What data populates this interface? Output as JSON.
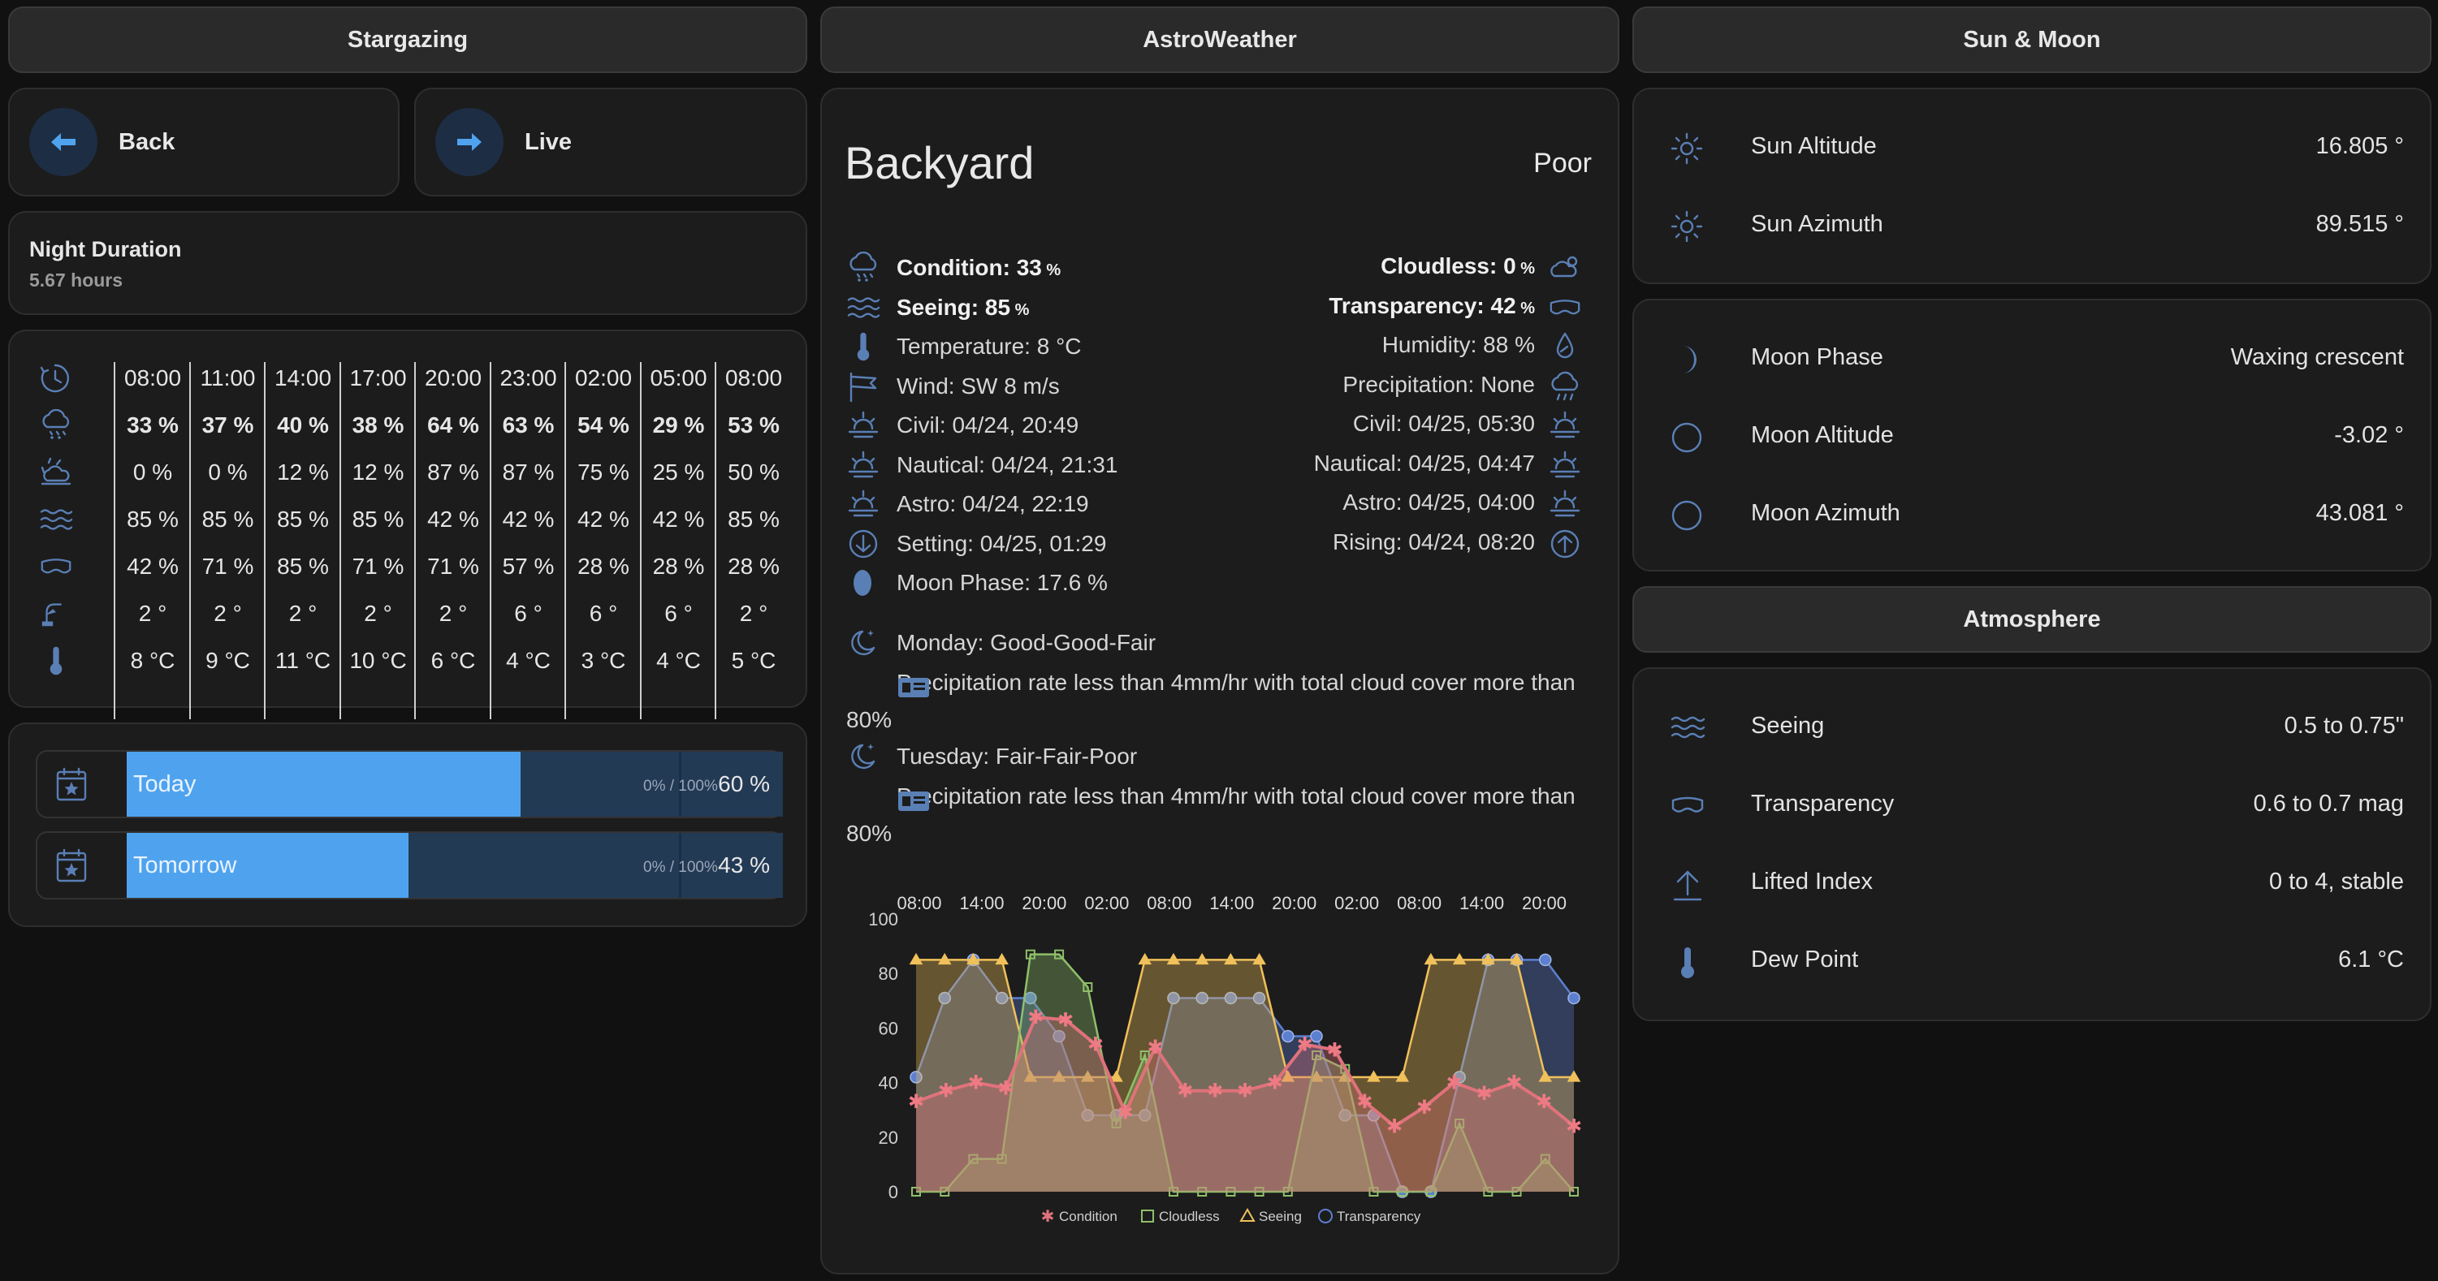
{
  "headers": {
    "left": "Stargazing",
    "middle": "AstroWeather",
    "right": "Sun & Moon",
    "atmosphere": "Atmosphere"
  },
  "nav": {
    "back": "Back",
    "live": "Live"
  },
  "night": {
    "title": "Night Duration",
    "value": "5.67 hours"
  },
  "forecast": {
    "times": [
      "08:00",
      "11:00",
      "14:00",
      "17:00",
      "20:00",
      "23:00",
      "02:00",
      "05:00",
      "08:00"
    ],
    "condition": [
      "33 %",
      "37 %",
      "40 %",
      "38 %",
      "64 %",
      "63 %",
      "54 %",
      "29 %",
      "53 %"
    ],
    "cloudless": [
      "0 %",
      "0 %",
      "12 %",
      "12 %",
      "87 %",
      "87 %",
      "75 %",
      "25 %",
      "50 %"
    ],
    "seeing": [
      "85 %",
      "85 %",
      "85 %",
      "85 %",
      "42 %",
      "42 %",
      "42 %",
      "42 %",
      "85 %"
    ],
    "transparency": [
      "42 %",
      "71 %",
      "85 %",
      "71 %",
      "71 %",
      "57 %",
      "28 %",
      "28 %",
      "28 %"
    ],
    "lifted": [
      "2 °",
      "2 °",
      "2 °",
      "2 °",
      "2 °",
      "6 °",
      "6 °",
      "6 °",
      "2 °"
    ],
    "temperature": [
      "8 °C",
      "9 °C",
      "11 °C",
      "10 °C",
      "6 °C",
      "4 °C",
      "3 °C",
      "4 °C",
      "5 °C"
    ]
  },
  "progress": [
    {
      "label": "Today",
      "range": "0% / 100%",
      "pct_text": "60 %",
      "value": 0.6
    },
    {
      "label": "Tomorrow",
      "range": "0% / 100%",
      "pct_text": "43 %",
      "value": 0.43
    }
  ],
  "astro": {
    "location": "Backyard",
    "rating": "Poor",
    "left": {
      "condition_label": "Condition: 33",
      "condition_unit": " %",
      "seeing_label": "Seeing: 85",
      "seeing_unit": " %",
      "temperature": "Temperature: 8 °C",
      "wind": "Wind: SW 8 m/s",
      "civil": "Civil: 04/24, 20:49",
      "nautical": "Nautical: 04/24, 21:31",
      "astro": "Astro: 04/24, 22:19",
      "setting": "Setting: 04/25, 01:29",
      "moon": "Moon Phase: 17.6 %"
    },
    "right": {
      "cloudless_label": "Cloudless: 0",
      "cloudless_unit": " %",
      "transparency_label": "Transparency: 42",
      "transparency_unit": " %",
      "humidity": "Humidity: 88 %",
      "precipitation": "Precipitation: None",
      "civil": "Civil: 04/25, 05:30",
      "nautical": "Nautical: 04/25, 04:47",
      "astro": "Astro: 04/25, 04:00",
      "rising": "Rising: 04/24, 08:20"
    },
    "daily": [
      {
        "day": "Monday: Good-Good-Fair",
        "desc": "Precipitation rate less than 4mm/hr with total cloud cover more than 80%"
      },
      {
        "day": "Tuesday: Fair-Fair-Poor",
        "desc": "Precipitation rate less than 4mm/hr with total cloud cover more than 80%"
      }
    ]
  },
  "chart_data": {
    "type": "area",
    "x_ticks": [
      "08:00",
      "14:00",
      "20:00",
      "02:00",
      "08:00",
      "14:00",
      "20:00",
      "02:00",
      "08:00",
      "14:00",
      "20:00"
    ],
    "ylim": [
      0,
      100
    ],
    "y_ticks": [
      0,
      20,
      40,
      60,
      80,
      100
    ],
    "series": [
      {
        "name": "Condition",
        "color": "#e0727b",
        "values": [
          33,
          37,
          40,
          38,
          64,
          63,
          54,
          29,
          53,
          37,
          37,
          37,
          40,
          54,
          52,
          33,
          24,
          31,
          40,
          36,
          40,
          33,
          24
        ]
      },
      {
        "name": "Cloudless",
        "color": "#8fbf6a",
        "values": [
          0,
          0,
          12,
          12,
          87,
          87,
          75,
          25,
          50,
          0,
          0,
          0,
          0,
          0,
          50,
          45,
          0,
          0,
          0,
          25,
          0,
          0,
          12,
          0
        ]
      },
      {
        "name": "Seeing",
        "color": "#f0c05a",
        "values": [
          85,
          85,
          85,
          85,
          42,
          42,
          42,
          42,
          85,
          85,
          85,
          85,
          85,
          42,
          42,
          42,
          42,
          42,
          85,
          85,
          85,
          85,
          42,
          42
        ]
      },
      {
        "name": "Transparency",
        "color": "#5c7fd0",
        "values": [
          42,
          71,
          85,
          71,
          71,
          57,
          28,
          28,
          28,
          71,
          71,
          71,
          71,
          57,
          57,
          28,
          28,
          0,
          0,
          42,
          85,
          85,
          85,
          71
        ]
      }
    ],
    "legend_position": "bottom"
  },
  "sun": {
    "rows": [
      {
        "label": "Sun Altitude",
        "value": "16.805 °"
      },
      {
        "label": "Sun Azimuth",
        "value": "89.515 °"
      }
    ]
  },
  "moon": {
    "rows": [
      {
        "label": "Moon Phase",
        "value": "Waxing crescent"
      },
      {
        "label": "Moon Altitude",
        "value": "-3.02 °"
      },
      {
        "label": "Moon Azimuth",
        "value": "43.081 °"
      }
    ]
  },
  "atmosphere": {
    "rows": [
      {
        "label": "Seeing",
        "value": "0.5 to 0.75\""
      },
      {
        "label": "Transparency",
        "value": "0.6 to 0.7 mag"
      },
      {
        "label": "Lifted Index",
        "value": "0 to 4, stable"
      },
      {
        "label": "Dew Point",
        "value": "6.1 °C"
      }
    ]
  },
  "colors": {
    "accent": "#4fa3ee",
    "icon": "#5a7fb5",
    "card": "#1c1c1c",
    "background": "#111111"
  }
}
